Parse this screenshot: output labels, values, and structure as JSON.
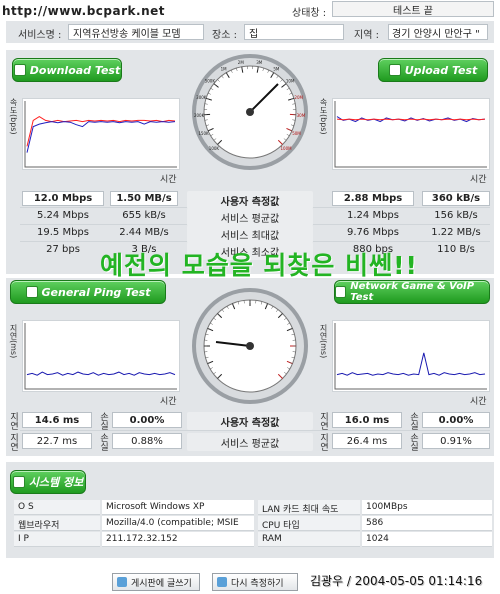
{
  "watermark_url": "http://www.bcpark.net",
  "header": {
    "status_label": "상태창 :",
    "status_value": "테스트 끝",
    "service_label": "서비스명 :",
    "service_value": "지역유선방송 케이블 모뎀",
    "place_label": "장소 :",
    "place_value": "집",
    "region_label": "지역 :",
    "region_value": "경기 안양시 만안구 \""
  },
  "download": {
    "title": "Download Test",
    "ylabel": "속도(bps)",
    "xlabel": "시간",
    "rows": [
      [
        "12.0 Mbps",
        "1.50 MB/s"
      ],
      [
        "5.24 Mbps",
        "655 kB/s"
      ],
      [
        "19.5 Mbps",
        "2.44 MB/s"
      ],
      [
        "27 bps",
        "3 B/s"
      ]
    ]
  },
  "upload": {
    "title": "Upload Test",
    "ylabel": "속도(bps)",
    "xlabel": "시간",
    "rows": [
      [
        "2.88 Mbps",
        "360 kB/s"
      ],
      [
        "1.24 Mbps",
        "156 kB/s"
      ],
      [
        "9.76 Mbps",
        "1.22 MB/s"
      ],
      [
        "880 bps",
        "110 B/s"
      ]
    ]
  },
  "speed_labels": [
    "사용자 측정값",
    "서비스 평균값",
    "서비스 최대값",
    "서비스 최소값"
  ],
  "gauge1_ticks": [
    "100K",
    "150K",
    "200K",
    "300K",
    "500K",
    "1M",
    "2M",
    "3M",
    "5M",
    "10M",
    "20M",
    "30M",
    "50M",
    "100M"
  ],
  "overlay_text": "예전의 모습을 되찾은 비쎈!!",
  "ping": {
    "title": "General Ping Test",
    "ylabel": "지연(ms)",
    "xlabel": "시간",
    "delay_label": "지연",
    "loss_label": "손실",
    "user_delay": "14.6 ms",
    "user_loss": "0.00%",
    "avg_delay": "22.7 ms",
    "avg_loss": "0.88%"
  },
  "game": {
    "title": "Network Game & VoIP Test",
    "ylabel": "지연(ms)",
    "xlabel": "시간",
    "delay_label": "지연",
    "loss_label": "손실",
    "user_delay": "16.0 ms",
    "user_loss": "0.00%",
    "avg_delay": "26.4 ms",
    "avg_loss": "0.91%"
  },
  "ping_labels": [
    "사용자 측정값",
    "서비스 평균값"
  ],
  "system": {
    "title": "시스템 정보",
    "rows": [
      {
        "k1": "O S",
        "v1": "Microsoft Windows XP",
        "k2": "LAN 카드 최대 속도",
        "v2": "100MBps"
      },
      {
        "k1": "웹브라우저",
        "v1": "Mozilla/4.0 (compatible; MSIE",
        "k2": "CPU 타입",
        "v2": "586"
      },
      {
        "k1": "I P",
        "v1": "211.172.32.152",
        "k2": "RAM",
        "v2": "1024"
      }
    ]
  },
  "footer": {
    "board_btn": "게시판에 글쓰기",
    "retest_btn": "다시 측정하기",
    "stamp": "김광우 / 2004-05-05 01:14:16"
  },
  "colors": {
    "accent_green": "#2aa02a",
    "download_series": "#ff2020",
    "upload_series": "#2020c0",
    "ping_series": "#1a1ab0",
    "overlay": "#23b423"
  },
  "chart_data": [
    {
      "type": "line",
      "ylabel": "속도(bps)",
      "xlabel": "시간",
      "series": [
        {
          "values": [
            0.3,
            0.72,
            0.78,
            0.72,
            0.7,
            0.72,
            0.7,
            0.71,
            0.72,
            0.7,
            0.72,
            0.71,
            0.72,
            0.71,
            0.72,
            0.7,
            0.72,
            0.71,
            0.72,
            0.72,
            0.71,
            0.72,
            0.7,
            0.72,
            0.71
          ]
        },
        {
          "values": [
            0.2,
            0.62,
            0.66,
            0.68,
            0.7,
            0.68,
            0.7,
            0.69,
            0.65,
            0.62,
            0.7,
            0.69,
            0.7,
            0.69,
            0.7,
            0.68,
            0.7,
            0.69,
            0.7,
            0.66,
            0.7,
            0.69,
            0.7,
            0.69,
            0.7
          ]
        }
      ]
    },
    {
      "type": "line",
      "ylabel": "속도(bps)",
      "xlabel": "시간",
      "series": [
        {
          "values": [
            0.78,
            0.72,
            0.74,
            0.7,
            0.76,
            0.72,
            0.74,
            0.7,
            0.76,
            0.73,
            0.74,
            0.71,
            0.76,
            0.72,
            0.75,
            0.71,
            0.74,
            0.73,
            0.76,
            0.72,
            0.74,
            0.7,
            0.75,
            0.73,
            0.74
          ]
        },
        {
          "values": [
            0.74,
            0.73,
            0.74,
            0.73,
            0.74,
            0.73,
            0.74,
            0.73,
            0.74,
            0.73,
            0.74,
            0.73,
            0.74,
            0.73,
            0.74,
            0.73,
            0.74,
            0.73,
            0.74,
            0.73,
            0.74,
            0.73,
            0.74,
            0.73,
            0.74
          ]
        }
      ]
    },
    {
      "type": "line",
      "ylabel": "지연(ms)",
      "xlabel": "시간",
      "series": [
        {
          "values": [
            0.2,
            0.22,
            0.19,
            0.24,
            0.2,
            0.21,
            0.23,
            0.19,
            0.22,
            0.2,
            0.24,
            0.21,
            0.2,
            0.23,
            0.19,
            0.22,
            0.2,
            0.21,
            0.24,
            0.2,
            0.22,
            0.19,
            0.23,
            0.21,
            0.2,
            0.22,
            0.2,
            0.21,
            0.23,
            0.2
          ]
        }
      ]
    },
    {
      "type": "line",
      "ylabel": "지연(ms)",
      "xlabel": "시간",
      "series": [
        {
          "values": [
            0.2,
            0.22,
            0.19,
            0.23,
            0.2,
            0.21,
            0.22,
            0.19,
            0.21,
            0.2,
            0.23,
            0.21,
            0.2,
            0.22,
            0.19,
            0.21,
            0.2,
            0.55,
            0.2,
            0.22,
            0.19,
            0.23,
            0.21,
            0.2,
            0.22,
            0.2,
            0.21,
            0.23,
            0.2,
            0.21
          ]
        }
      ]
    }
  ]
}
